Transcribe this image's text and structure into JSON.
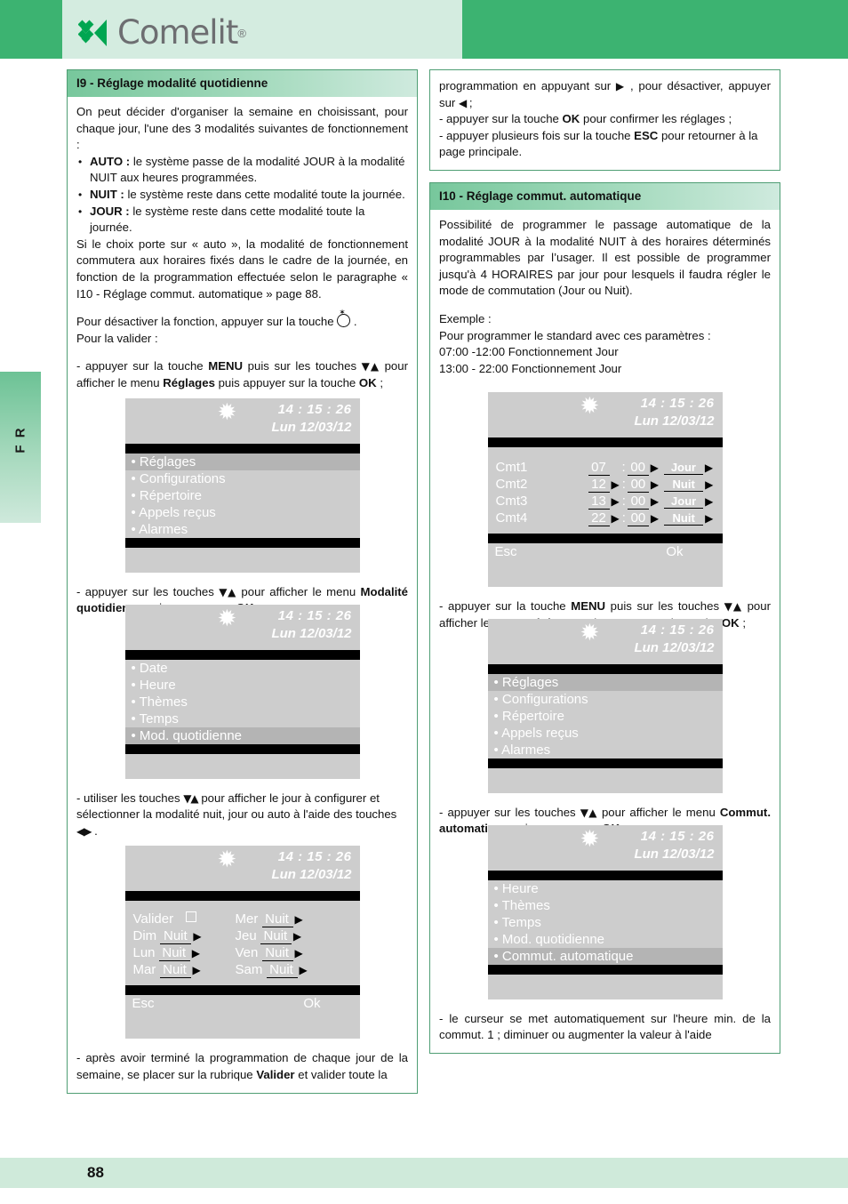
{
  "brand": {
    "name": "Comelit",
    "registered": "®"
  },
  "side_tab": {
    "label": "F R"
  },
  "footer": {
    "page_number": "88"
  },
  "screen_common": {
    "time": "14 : 15 : 26",
    "date": "Lun 12/03/12",
    "star_icon": "✹",
    "esc": "Esc",
    "ok": "Ok"
  },
  "left": {
    "section": {
      "title": "I9 - Réglage modalité quotidienne",
      "intro": "On peut décider d'organiser la semaine en choisissant, pour chaque jour, l'une des 3 modalités suivantes de fonctionnement :",
      "bullets": [
        {
          "lead": "AUTO :",
          "text": " le système passe de la modalité JOUR à la modalité NUIT aux heures programmées."
        },
        {
          "lead": "NUIT :",
          "text": " le système reste dans cette modalité toute la journée."
        },
        {
          "lead": "JOUR :",
          "text": " le système reste dans cette modalité toute la journée."
        }
      ],
      "after_bullets": "Si le choix porte sur « auto », la modalité de fonctionnement commutera aux horaires fixés dans le cadre de la journée, en fonction de la programmation effectuée selon le paragraphe « I10 - Réglage commut. automatique » page 88.",
      "deactivate_pre": "Pour désactiver la fonction, appuyer sur la touche ",
      "deactivate_post": " .",
      "validate": "Pour la valider :",
      "step1_a": " - appuyer sur la touche ",
      "step1_menu": "MENU",
      "step1_b": " puis sur les touches ",
      "step1_c": " pour afficher le menu ",
      "step1_reglages": "Réglages",
      "step1_d": " puis appuyer sur la touche ",
      "step1_ok": "OK",
      "step1_e": " ;",
      "step2_a": "- appuyer sur les touches ",
      "step2_b": " pour afficher le menu ",
      "step2_bold": "Modalité quotidienne",
      "step2_c": " puis appuyer sur ",
      "step2_ok": "OK",
      "step2_d": " ;",
      "step3_a": "- utiliser les touches ",
      "step3_b": " pour afficher le jour à configurer et sélectionner la modalité nuit, jour ou auto à l'aide des touches ",
      "step3_c": " .",
      "step4_a": "- après avoir terminé la programmation de chaque jour de la semaine, se placer sur la rubrique ",
      "step4_bold": "Valider",
      "step4_b": " et valider toute la"
    },
    "screen_main_menu": {
      "items": [
        {
          "label": "• Réglages",
          "selected": true
        },
        {
          "label": "• Configurations",
          "selected": false
        },
        {
          "label": "• Répertoire",
          "selected": false
        },
        {
          "label": "• Appels reçus",
          "selected": false
        },
        {
          "label": "• Alarmes",
          "selected": false
        }
      ]
    },
    "screen_reglages_menu": {
      "items": [
        {
          "label": "• Date",
          "selected": false
        },
        {
          "label": "• Heure",
          "selected": false
        },
        {
          "label": "• Thèmes",
          "selected": false
        },
        {
          "label": "• Temps",
          "selected": false
        },
        {
          "label": "• Mod. quotidienne",
          "selected": true
        }
      ]
    },
    "screen_days": {
      "valider_label": "Valider",
      "rows": [
        {
          "left_day": "Valider",
          "left_value": "",
          "right_day": "Mer",
          "right_value": "Nuit"
        },
        {
          "left_day": "Dim",
          "left_value": "Nuit",
          "right_day": "Jeu",
          "right_value": "Nuit"
        },
        {
          "left_day": "Lun",
          "left_value": "Nuit",
          "right_day": "Ven",
          "right_value": "Nuit"
        },
        {
          "left_day": "Mar",
          "left_value": "Nuit",
          "right_day": "Sam",
          "right_value": "Nuit"
        }
      ]
    }
  },
  "right": {
    "top_box": {
      "l1_a": "programmation en appuyant sur ",
      "l1_b": " , pour désactiver, appuyer sur ",
      "l1_c": " ;",
      "l2_a": "- appuyer sur la touche ",
      "l2_ok": "OK",
      "l2_b": " pour confirmer les réglages ;",
      "l3_a": "- appuyer plusieurs fois sur la touche ",
      "l3_esc": "ESC",
      "l3_b": " pour retourner à la page principale."
    },
    "section": {
      "title": "I10 - Réglage commut. automatique",
      "intro": "Possibilité de programmer le passage automatique de la modalité JOUR à la modalité NUIT à des horaires déterminés programmables par l’usager. Il est possible de programmer jusqu'à 4 HORAIRES par jour pour lesquels il faudra régler le mode de commutation (Jour ou Nuit).",
      "example_label": "Exemple  :",
      "example_l1": "Pour programmer le standard avec ces paramètres :",
      "example_l2": "07:00 -12:00 Fonctionnement Jour",
      "example_l3": "13:00 - 22:00 Fonctionnement Jour",
      "step1_a": "- appuyer sur la touche ",
      "step1_menu": "MENU",
      "step1_b": " puis sur les touches ",
      "step1_c": " pour afficher le menu ",
      "step1_reglages": "Réglages",
      "step1_d": " puis appuyer sur la touche ",
      "step1_ok": "OK",
      "step1_e": " ;",
      "step2_a": "- appuyer sur les touches ",
      "step2_b": " pour afficher le menu ",
      "step2_bold": "Commut. automatique",
      "step2_c": " puis appuyer sur ",
      "step2_ok": "OK",
      "step2_d": " ;",
      "step3": "- le curseur se met automatiquement sur l'heure min. de la commut. 1 ; diminuer ou augmenter la valeur à l'aide"
    },
    "screen_cmt": {
      "rows": [
        {
          "name": "Cmt1",
          "hour": "07",
          "hour_arrow": false,
          "minute": "00",
          "minute_arrow": true,
          "mode": "Jour",
          "mode_arrow": true
        },
        {
          "name": "Cmt2",
          "hour": "12",
          "hour_arrow": true,
          "minute": "00",
          "minute_arrow": true,
          "mode": "Nuit",
          "mode_arrow": true
        },
        {
          "name": "Cmt3",
          "hour": "13",
          "hour_arrow": true,
          "minute": "00",
          "minute_arrow": true,
          "mode": "Jour",
          "mode_arrow": true
        },
        {
          "name": "Cmt4",
          "hour": "22",
          "hour_arrow": true,
          "minute": "00",
          "minute_arrow": true,
          "mode": "Nuit",
          "mode_arrow": true
        }
      ]
    },
    "screen_main_menu": {
      "items": [
        {
          "label": "• Réglages",
          "selected": true
        },
        {
          "label": "• Configurations",
          "selected": false
        },
        {
          "label": "• Répertoire",
          "selected": false
        },
        {
          "label": "• Appels reçus",
          "selected": false
        },
        {
          "label": "• Alarmes",
          "selected": false
        }
      ]
    },
    "screen_reglages_menu": {
      "items": [
        {
          "label": "• Heure",
          "selected": false
        },
        {
          "label": "• Thèmes",
          "selected": false
        },
        {
          "label": "• Temps",
          "selected": false
        },
        {
          "label": "• Mod. quotidienne",
          "selected": false
        },
        {
          "label": "• Commut. automatique",
          "selected": true
        }
      ]
    }
  },
  "glyphs": {
    "down_up": "▼▲",
    "left_right": "◀▶",
    "right": "▶",
    "left": "◀",
    "sparkle": "✶"
  },
  "colors": {
    "brand_green": "#3cb371",
    "band_light": "#d4ece0",
    "header_green": "#77c79c",
    "screen_bg": "#cdcdcd",
    "screen_sel": "#b4b4b4",
    "footer": "#cfeada"
  }
}
